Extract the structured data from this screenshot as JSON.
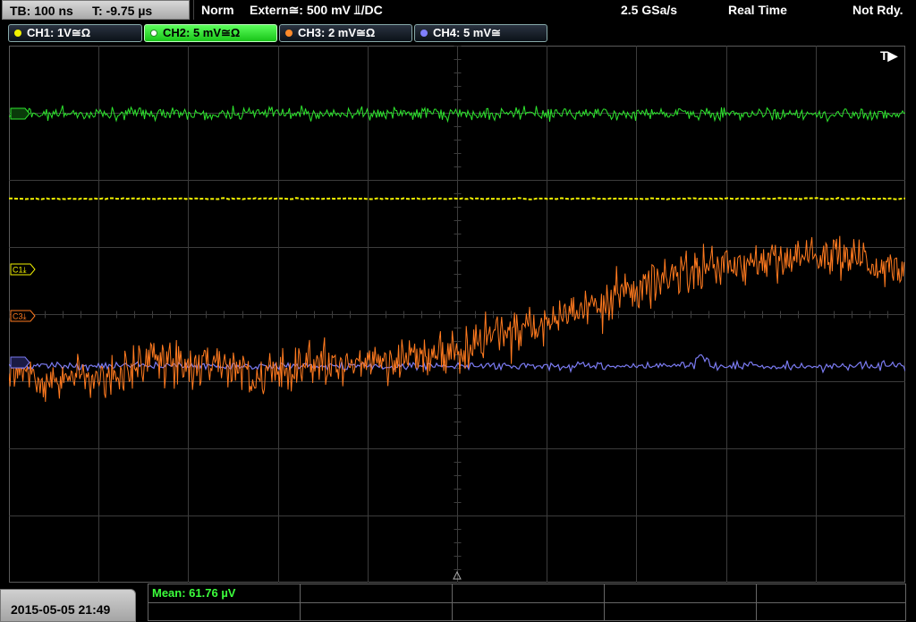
{
  "topbar": {
    "timebase": "TB: 100 ns",
    "trigger_time": "T: -9.75 µs",
    "mode": "Norm",
    "trigger_source": "Extern≅: 500 mV ⫫/DC",
    "sample_rate": "2.5 GSa/s",
    "acquisition": "Real Time",
    "state": "Not Rdy."
  },
  "channels": [
    {
      "label": "CH1: 1V≅Ω",
      "color": "#f2f200"
    },
    {
      "label": "CH2: 5 mV≅Ω",
      "color": "#2ee62e",
      "active": true
    },
    {
      "label": "CH3: 2 mV≅Ω",
      "color": "#ff8a2a"
    },
    {
      "label": "CH4: 5 mV≅",
      "color": "#8080ff"
    }
  ],
  "markers": {
    "trigger": "T▶",
    "c1": "C1⤓",
    "c3": "C3⤓"
  },
  "bottom": {
    "datetime": "2015-05-05 21:49",
    "mean": "Mean: 61.76 µV"
  },
  "colors": {
    "grid": "#3c3c3c",
    "ch1": "#f2f200",
    "ch2": "#2ee62e",
    "ch3": "#ff7a1f",
    "ch4": "#7b7bf2"
  }
}
